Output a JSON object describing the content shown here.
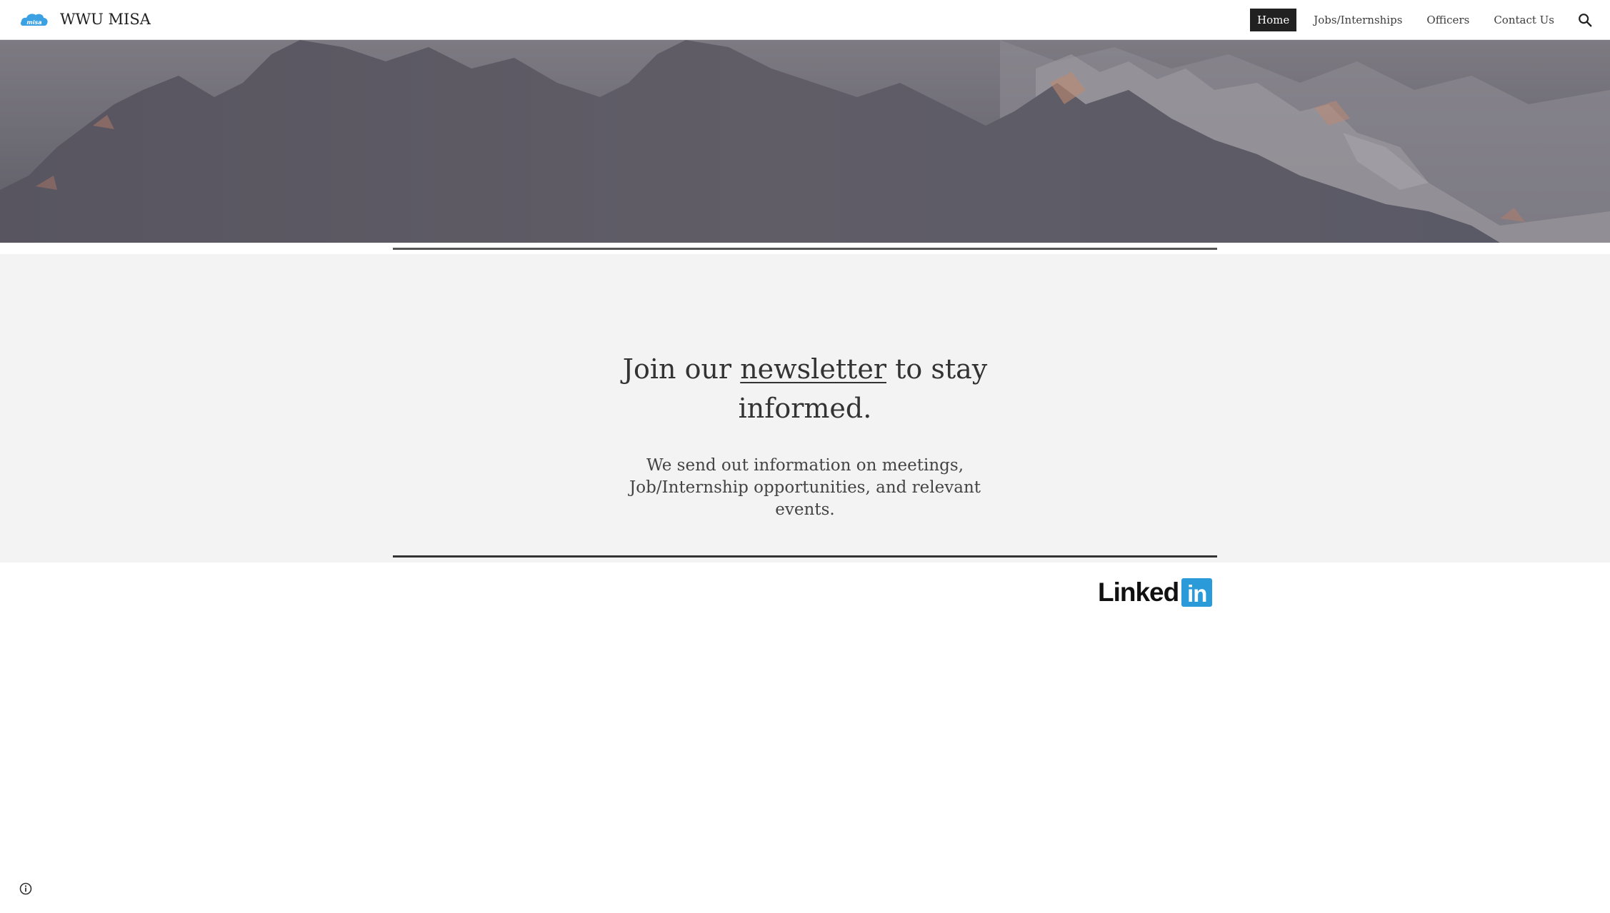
{
  "header": {
    "site_title": "WWU MISA",
    "logo_text": "misa",
    "logo_icon": "cloud-logo-icon",
    "nav": [
      {
        "label": "Home",
        "active": true
      },
      {
        "label": "Jobs/Internships",
        "active": false
      },
      {
        "label": "Officers",
        "active": false
      },
      {
        "label": "Contact Us",
        "active": false
      }
    ],
    "search_icon": "search-icon"
  },
  "newsletter": {
    "headline_before": "Join our ",
    "headline_link": "newsletter",
    "headline_after": " to stay informed.",
    "description": "We send out information on meetings, Job/Internship opportunities, and relevant events."
  },
  "linkedin": {
    "text": "Linked",
    "badge": "in"
  },
  "footer": {
    "info_icon": "info-icon"
  },
  "colors": {
    "accent": "#2a9ad8",
    "nav_active_bg": "#212121",
    "band_bg": "#f3f3f3"
  }
}
